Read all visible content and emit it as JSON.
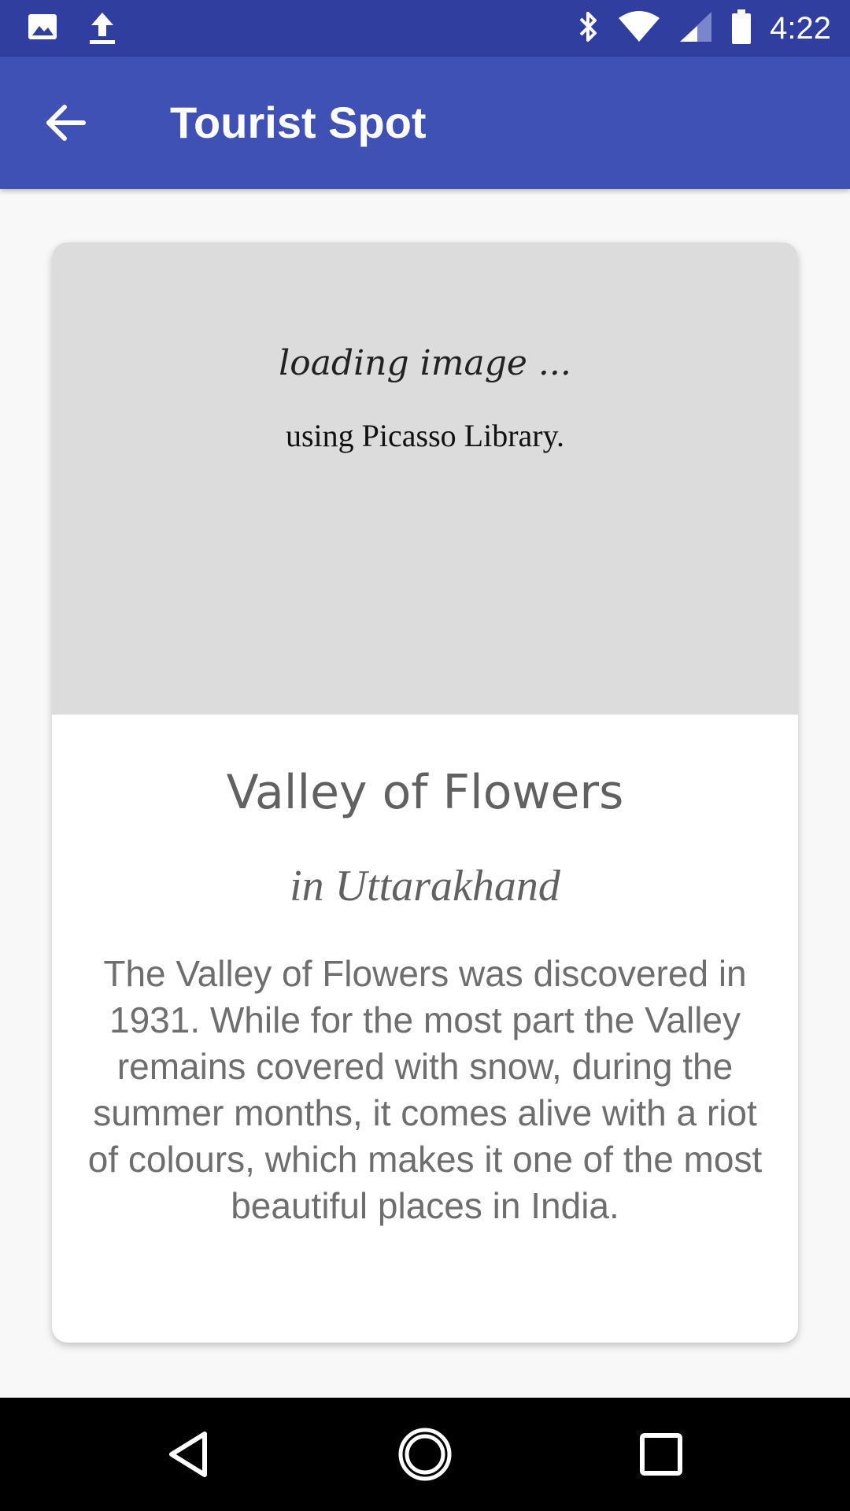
{
  "status_bar": {
    "time": "4:22",
    "icons": [
      "image-icon",
      "upload-icon",
      "bluetooth-icon",
      "wifi-icon",
      "cell-signal-icon",
      "battery-icon"
    ]
  },
  "app_bar": {
    "title": "Tourist Spot",
    "back_icon": "arrow-back-icon",
    "color": "#3f51b5"
  },
  "card": {
    "image_placeholder": {
      "line1": "loading image ...",
      "line2": "using Picasso Library."
    },
    "name": "Valley of Flowers",
    "location": "in Uttarakhand",
    "description": "The Valley of Flowers was discovered in 1931. While for the most part the Valley remains covered with snow, during the summer months, it comes alive with a riot of colours, which makes it one of the most beautiful places in India."
  },
  "nav_bar": {
    "icons": [
      "back-triangle-icon",
      "home-circle-icon",
      "recents-square-icon"
    ]
  },
  "colors": {
    "status_bar": "#303f9f",
    "app_bar": "#3f51b5",
    "text_secondary": "#616161"
  }
}
